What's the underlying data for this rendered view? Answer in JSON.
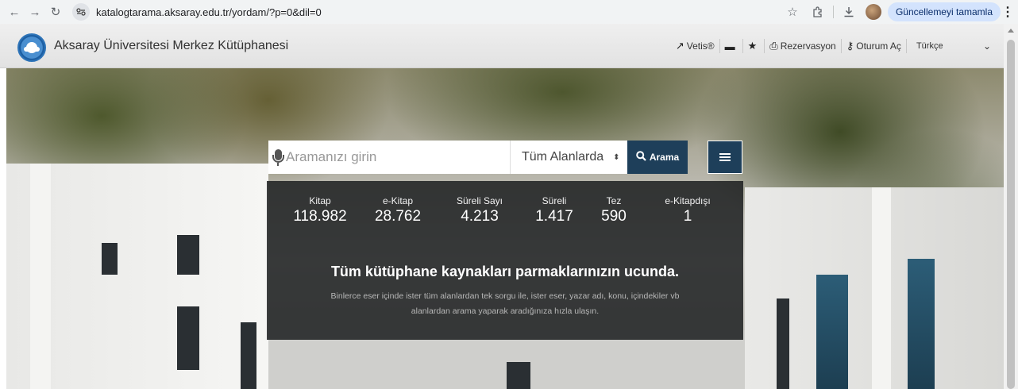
{
  "browser": {
    "url": "katalogtarama.aksaray.edu.tr/yordam/?p=0&dil=0",
    "update_label": "Güncellemeyi tamamla"
  },
  "header": {
    "title": "Aksaray Üniversitesi Merkez Kütüphanesi",
    "nav": {
      "vetis": "Vetis®",
      "reservation": "Rezervasyon",
      "login": "Oturum Aç",
      "language": "Türkçe"
    }
  },
  "search": {
    "placeholder": "Aramanızı girin",
    "scope": "Tüm Alanlarda",
    "button_label": "Arama"
  },
  "stats": [
    {
      "label": "Kitap",
      "value": "118.982"
    },
    {
      "label": "e-Kitap",
      "value": "28.762"
    },
    {
      "label": "Süreli Sayı",
      "value": "4.213"
    },
    {
      "label": "Süreli",
      "value": "1.417"
    },
    {
      "label": "Tez",
      "value": "590"
    },
    {
      "label": "e-Kitapdışı",
      "value": "1"
    }
  ],
  "hero": {
    "tagline": "Tüm kütüphane kaynakları parmaklarınızın ucunda.",
    "description_line1": "Binlerce eser içinde ister tüm alanlardan tek sorgu ile, ister eser, yazar adı, konu, içindekiler vb",
    "description_line2": "alanlardan arama yaparak aradığınıza hızla ulaşın."
  }
}
